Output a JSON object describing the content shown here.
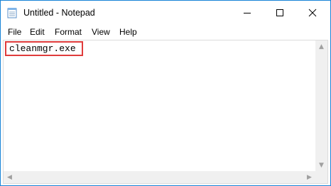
{
  "window": {
    "title": "Untitled - Notepad",
    "icon": "notepad-icon",
    "controls": [
      "minimize-icon",
      "maximize-icon",
      "close-icon"
    ]
  },
  "menu": {
    "file": "File",
    "edit": "Edit",
    "format": "Format",
    "view": "View",
    "help": "Help"
  },
  "editor": {
    "text": "cleanmgr.exe"
  },
  "colors": {
    "highlight_border": "#e03c3c",
    "window_border": "#1883d7"
  }
}
